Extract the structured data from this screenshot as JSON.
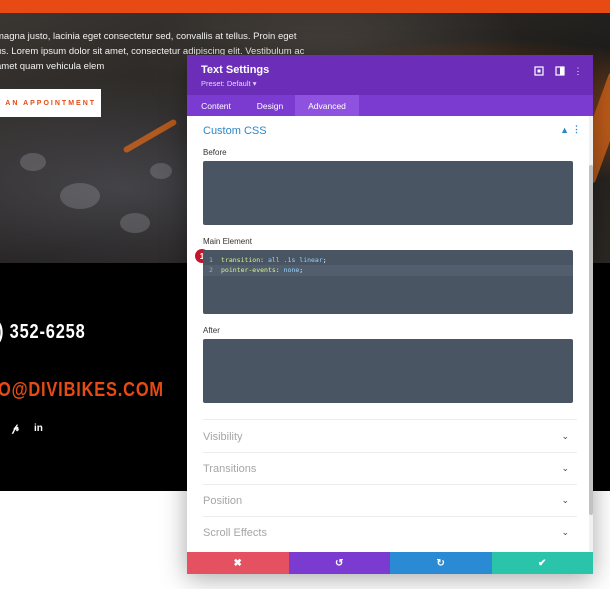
{
  "website": {
    "hero_lines": [
      "magna justo, lacinia eget consectetur sed, convallis at tellus. Proin eget",
      "us. Lorem ipsum dolor sit amet, consectetur adipiscing elit. Vestibulum ac",
      "amet quam vehicula elem"
    ],
    "appointment_label": "E AN APPOINTMENT",
    "phone": ") 352-6258",
    "email": "O@DIVIBIKES.COM",
    "social_icons": [
      "pinterest-icon",
      "linkedin-icon"
    ]
  },
  "modal": {
    "title": "Text Settings",
    "preset": "Preset: Default ▾",
    "tabs": [
      {
        "label": "Content",
        "active": false
      },
      {
        "label": "Design",
        "active": false
      },
      {
        "label": "Advanced",
        "active": true
      }
    ],
    "custom_css": {
      "title": "Custom CSS",
      "before_label": "Before",
      "main_label": "Main Element",
      "after_label": "After",
      "main_code": [
        {
          "line": "1",
          "prop": "transition",
          "value": "all .1s linear"
        },
        {
          "line": "2",
          "prop": "pointer-events",
          "value": "none"
        }
      ],
      "badge": "1"
    },
    "sections": [
      "Visibility",
      "Transitions",
      "Position",
      "Scroll Effects"
    ],
    "footer_buttons": [
      {
        "name": "discard",
        "icon": "✖",
        "color": "#e45261"
      },
      {
        "name": "undo",
        "icon": "↺",
        "color": "#7b3bd1"
      },
      {
        "name": "redo",
        "icon": "↻",
        "color": "#2a8ad4"
      },
      {
        "name": "save",
        "icon": "✔",
        "color": "#29c4a9"
      }
    ]
  },
  "colors": {
    "accent_orange": "#e84a14",
    "modal_header": "#6c2eb9",
    "code_bg": "#4a5563"
  }
}
